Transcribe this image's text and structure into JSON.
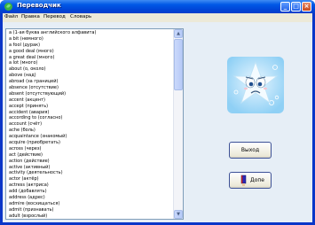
{
  "window": {
    "title": "Переводчик",
    "buttons": {
      "minimize": "_",
      "maximize": "□",
      "close": "×"
    }
  },
  "menu": {
    "items": [
      {
        "label": "Файл"
      },
      {
        "label": "Правка"
      },
      {
        "label": "Перевод"
      },
      {
        "label": "Словарь"
      }
    ]
  },
  "word_list": {
    "items": [
      "a (1-ая буква английского алфавита)",
      "a bit (немного)",
      "a fool (дурак)",
      "a good deal (много)",
      "a great deal (много)",
      "a lot (много)",
      "about (о, около)",
      "above (над)",
      "abroad (за границей)",
      "absence (отсутствие)",
      "absent (отсутствующий)",
      "accent (акцент)",
      "accept (принять)",
      "accident (авария)",
      "according to (согласно)",
      "account (счёт)",
      "ache (боль)",
      "acquaintance (знакомый)",
      "acquire (приобретать)",
      "across (через)",
      "act (действие)",
      "action (действие)",
      "active (активный)",
      "activity (деятельность)",
      "actor (актёр)",
      "actress (актриса)",
      "add (добавлять)",
      "address (адрес)",
      "admire (восхищаться)",
      "admit (признавать)",
      "adult (взрослый)",
      "advance (продвижение)"
    ],
    "scroll_up": "▲",
    "scroll_down": "▼"
  },
  "buttons": {
    "exit_label": "Выход",
    "help_label": "Допе"
  },
  "colors": {
    "titlebar": "#0058e6",
    "window_frame": "#0a36c8",
    "client_bg": "#e6eef6",
    "menu_bg": "#ece9d8",
    "list_border": "#7f9db9"
  },
  "icons": {
    "app": "green-leaf-icon",
    "mascot": "sad-cartoon-star-mascot",
    "help": "book-with-hand-icon"
  }
}
